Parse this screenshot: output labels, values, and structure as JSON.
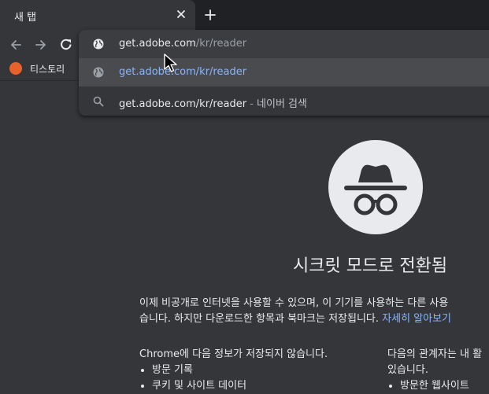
{
  "tab": {
    "title": "새 탭"
  },
  "bookmarks": {
    "items": [
      {
        "label": "티스토리"
      }
    ]
  },
  "omnibox": {
    "input": {
      "host": "get.adobe.com",
      "path": "/kr/reader"
    },
    "suggestions": [
      {
        "text": "get.adobe.com/kr/reader",
        "icon": "globe-icon"
      },
      {
        "text": "get.adobe.com/kr/reader",
        "separator": " - ",
        "description": "네이버 검색",
        "icon": "search-icon"
      }
    ]
  },
  "incognito": {
    "heading": "시크릿 모드로 전환됨",
    "para_line1": "이제 비공개로 인터넷을 사용할 수 있으며, 이 기기를 사용하는 다른 사용",
    "para_line2": "습니다. 하지만 다운로드한 항목과 북마크는 저장됩니다.",
    "learn_more": "자세히 알아보기",
    "not_saved_title": "Chrome에 다음 정보가 저장되지 않습니다.",
    "not_saved_items": [
      "방문 기록",
      "쿠키 및 사이트 데이터"
    ],
    "visible_title_line1": "다음의 관계자는 내 활",
    "visible_title_line2": "있습니다.",
    "visible_items": [
      "방문한 웹사이트"
    ]
  },
  "colors": {
    "accent_link": "#8ab4f8",
    "background": "#35363a",
    "tab_strip": "#202124"
  }
}
